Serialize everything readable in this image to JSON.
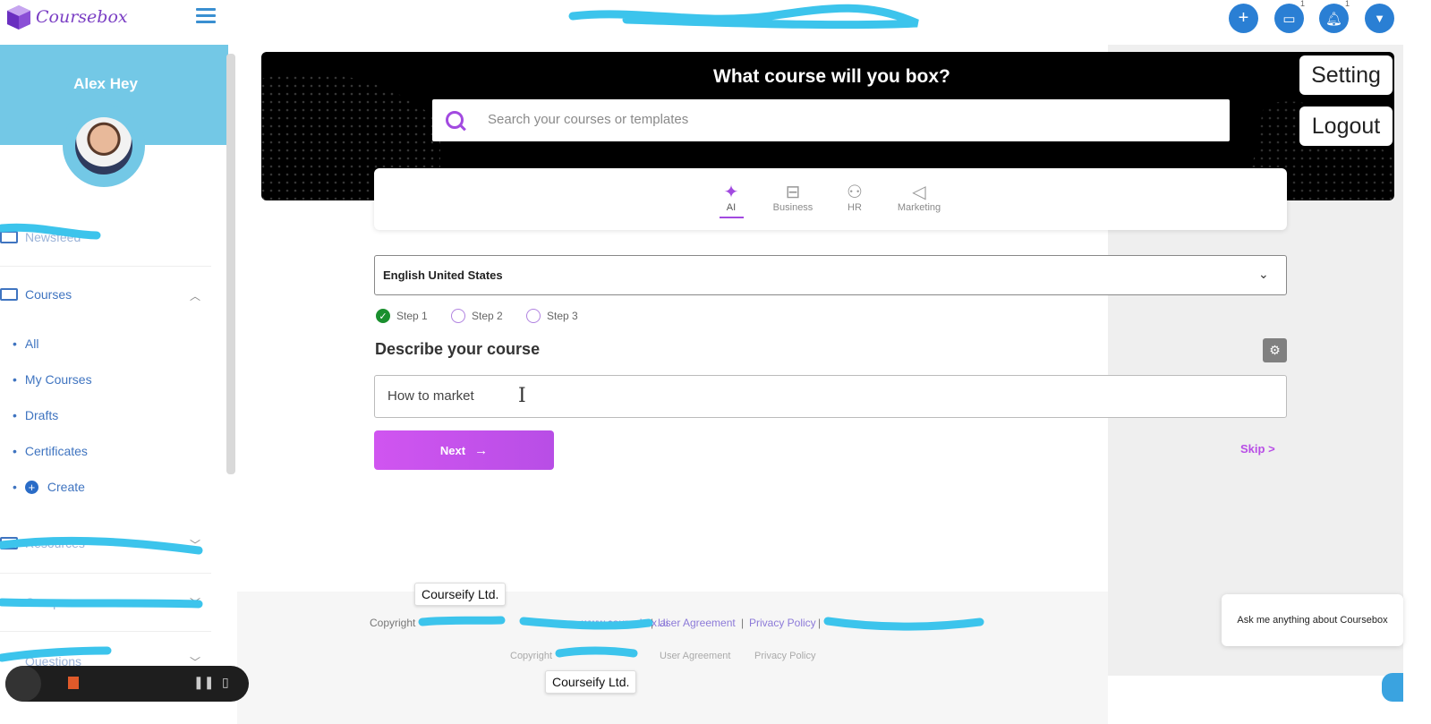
{
  "app": {
    "name": "Coursebox",
    "brand_color": "#7b3fc4",
    "accent_color": "#a24ae0",
    "blue": "#2a7fd4"
  },
  "topbar": {
    "icons": [
      "plus-icon",
      "chat-icon",
      "bell-icon",
      "chevron-down-icon"
    ],
    "chat_badge": "1",
    "bell_badge": "1"
  },
  "sidebar": {
    "user_name": "Alex Hey",
    "nav": {
      "newsfeed": "Newsfeed",
      "courses": "Courses",
      "courses_sub": [
        "All",
        "My Courses",
        "Drafts",
        "Certificates",
        "Create"
      ],
      "resources": "Resources",
      "groups": "Groups",
      "questions": "Questions"
    }
  },
  "hero": {
    "title": "What course will you box?",
    "search_placeholder": "Search your courses or templates"
  },
  "overlay_buttons": {
    "setting": "Setting",
    "logout": "Logout"
  },
  "tabs": [
    {
      "label": "AI",
      "icon": "sparkle-icon",
      "active": true
    },
    {
      "label": "Business",
      "icon": "briefcase-icon",
      "active": false
    },
    {
      "label": "HR",
      "icon": "person-icon",
      "active": false
    },
    {
      "label": "Marketing",
      "icon": "megaphone-icon",
      "active": false
    }
  ],
  "language": {
    "selected": "English United States"
  },
  "steps": [
    "Step 1",
    "Step 2",
    "Step 3"
  ],
  "describe": {
    "title": "Describe your course",
    "input_value": "How to market"
  },
  "next_label": "Next",
  "skip_label": "Skip >",
  "footer": {
    "copyright": "Copyright",
    "site": "www.coursebox.ai",
    "user_agreement": "User Agreement",
    "privacy_policy": "Privacy Policy",
    "tooltip": "Courseify Ltd."
  },
  "chat_prompt": "Ask me anything about Coursebox"
}
